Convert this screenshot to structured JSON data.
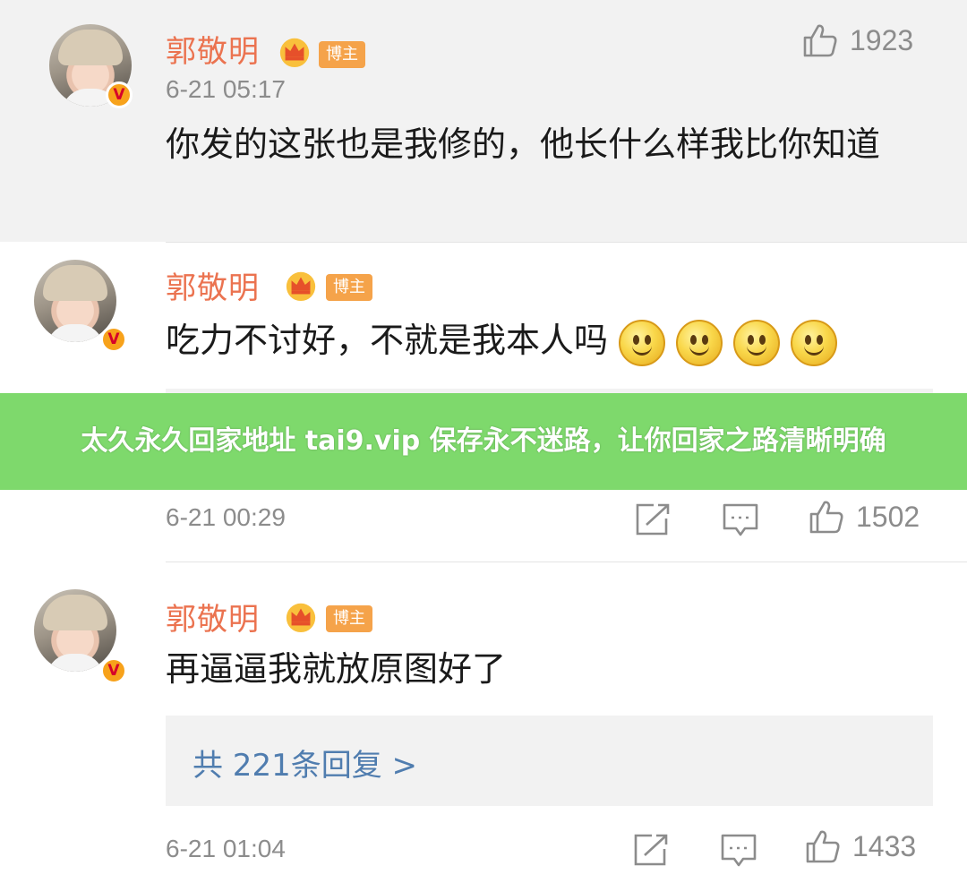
{
  "comments": [
    {
      "author": "郭敬明",
      "role_badge": "博主",
      "time": "6-21 05:17",
      "likes": "1923",
      "text": "你发的这张也是我修的，他长什么样我比你知道"
    },
    {
      "author": "郭敬明",
      "role_badge": "博主",
      "text": "吃力不讨好，不就是我本人吗",
      "emoji_count": 4,
      "time": "6-21 00:29",
      "likes": "1502"
    },
    {
      "author": "郭敬明",
      "role_badge": "博主",
      "text": "再逼逼我就放原图好了",
      "replies_link": "共 221条回复 >",
      "time": "6-21 01:04",
      "likes": "1433"
    }
  ],
  "overlay_banner": "太久永久回家地址 tai9.vip 保存永不迷路，让你回家之路清晰明确",
  "colors": {
    "name": "#eb7350",
    "role_badge_bg": "#f5a34a",
    "link": "#507daf",
    "banner_bg": "#7ed96c",
    "meta": "#8c8c8c"
  },
  "icons": [
    "verified-v-icon",
    "crown-icon",
    "thumb-up-icon",
    "share-edit-icon",
    "comment-bubble-icon",
    "smile-emoji-icon"
  ]
}
